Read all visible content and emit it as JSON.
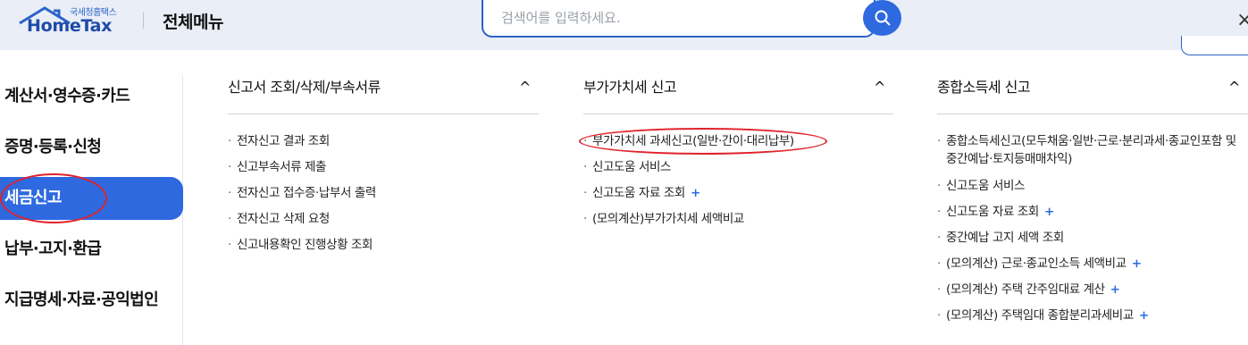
{
  "header": {
    "logo_small": "국세청홈택스",
    "logo_main": "HomeTax",
    "title": "전체메뉴",
    "search_placeholder": "검색어를 입력하세요.",
    "close_label": "×"
  },
  "sidebar": {
    "items": [
      {
        "label": "계산서·영수증·카드",
        "active": false
      },
      {
        "label": "증명·등록·신청",
        "active": false
      },
      {
        "label": "세금신고",
        "active": true
      },
      {
        "label": "납부·고지·환급",
        "active": false
      },
      {
        "label": "지급명세·자료·공익법인",
        "active": false
      }
    ]
  },
  "columns": [
    {
      "title": "신고서 조회/삭제/부속서류",
      "items": [
        {
          "label": "전자신고 결과 조회",
          "plus": false
        },
        {
          "label": "신고부속서류 제출",
          "plus": false
        },
        {
          "label": "전자신고 접수증·납부서 출력",
          "plus": false
        },
        {
          "label": "전자신고 삭제 요청",
          "plus": false
        },
        {
          "label": "신고내용확인 진행상황 조회",
          "plus": false
        }
      ]
    },
    {
      "title": "부가가치세 신고",
      "items": [
        {
          "label": "부가가치세 과세신고(일반·간이·대리납부)",
          "plus": false
        },
        {
          "label": "신고도움 서비스",
          "plus": false
        },
        {
          "label": "신고도움 자료 조회",
          "plus": true
        },
        {
          "label": "(모의계산)부가가치세 세액비교",
          "plus": false
        }
      ]
    },
    {
      "title": "종합소득세 신고",
      "items": [
        {
          "label": "종합소득세신고(모두채움·일반·근로·분리과세·종교인포함 및 중간예납·토지등매매차익)",
          "plus": false
        },
        {
          "label": "신고도움 서비스",
          "plus": false
        },
        {
          "label": "신고도움 자료 조회",
          "plus": true
        },
        {
          "label": "중간예납 고지 세액 조회",
          "plus": false
        },
        {
          "label": "(모의계산) 근로·종교인소득 세액비교",
          "plus": true
        },
        {
          "label": "(모의계산) 주택 간주임대료 계산",
          "plus": true
        },
        {
          "label": "(모의계산) 주택임대 종합분리과세비교",
          "plus": true
        }
      ]
    }
  ],
  "plus_symbol": "+",
  "caret_symbol": "^"
}
